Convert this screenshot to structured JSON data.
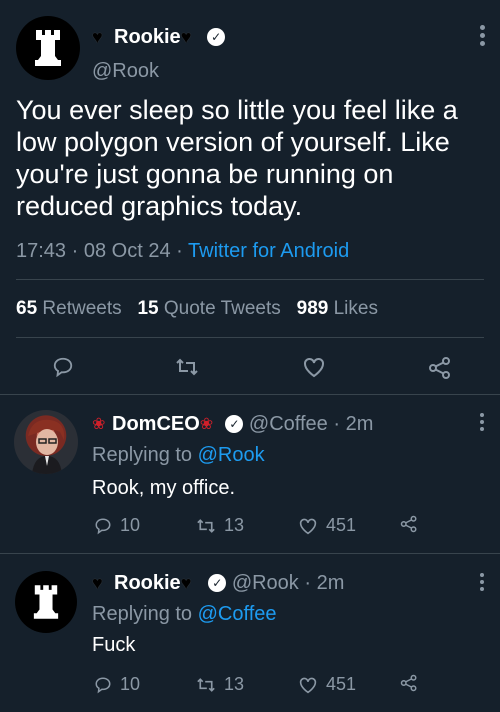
{
  "main_tweet": {
    "display_name": "Rookie",
    "handle": "@Rook",
    "text": "You ever sleep so little you feel like a low polygon version of yourself. Like you're just gonna be running on reduced graphics today.",
    "time": "17:43",
    "sep1": "·",
    "date": "08 Oct 24",
    "sep2": "·",
    "client": "Twitter for Android",
    "stats": {
      "retweets_count": "65",
      "retweets_label": "Retweets",
      "quotes_count": "15",
      "quotes_label": "Quote Tweets",
      "likes_count": "989",
      "likes_label": "Likes"
    }
  },
  "replies": [
    {
      "display_name": "DomCEO",
      "handle": "@Coffee",
      "age": "· 2m",
      "replying_prefix": "Replying to",
      "replying_to": "@Rook",
      "text": "Rook, my office.",
      "replies": "10",
      "retweets": "13",
      "likes": "451"
    },
    {
      "display_name": "Rookie",
      "handle": "@Rook",
      "age": "· 2m",
      "replying_prefix": "Replying to",
      "replying_to": "@Coffee",
      "text": "Fuck",
      "replies": "10",
      "retweets": "13",
      "likes": "451"
    }
  ],
  "icons": {
    "verified": "✓",
    "heart_emoji": "♥",
    "rose": "❀"
  },
  "colors": {
    "background": "#15202b",
    "accent": "#1d9bf0",
    "muted": "#8b98a5",
    "divider": "#38444d"
  }
}
